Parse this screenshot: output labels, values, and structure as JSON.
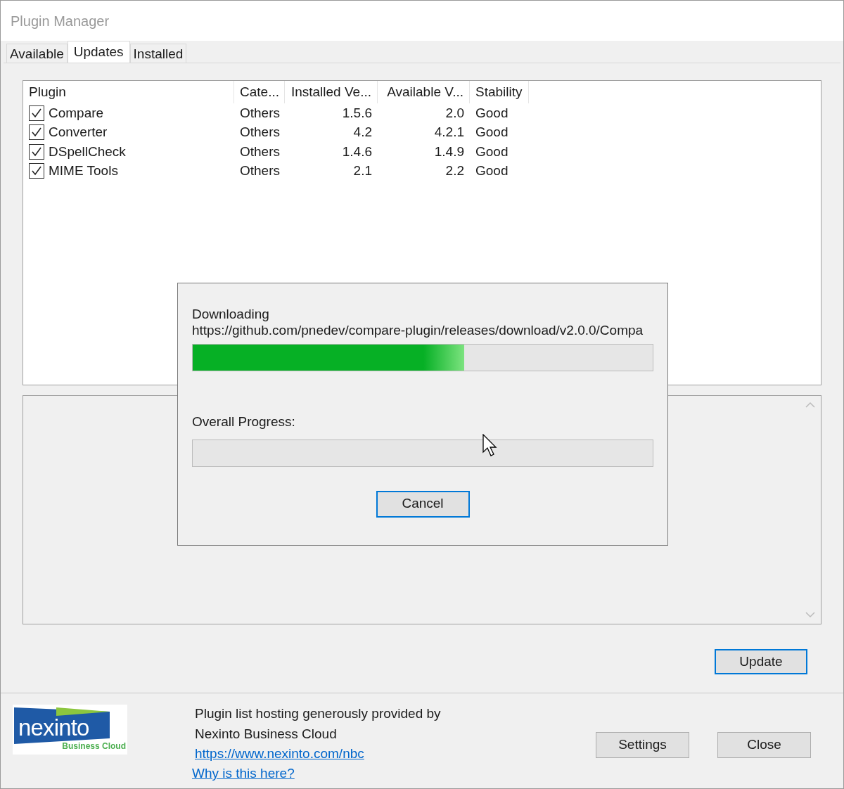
{
  "window": {
    "title": "Plugin Manager"
  },
  "tabs": [
    {
      "label": "Available",
      "selected": false
    },
    {
      "label": "Updates",
      "selected": true
    },
    {
      "label": "Installed",
      "selected": false
    }
  ],
  "table": {
    "columns": [
      {
        "label": "Plugin"
      },
      {
        "label": "Cate..."
      },
      {
        "label": "Installed Ve..."
      },
      {
        "label": "Available V..."
      },
      {
        "label": "Stability"
      }
    ],
    "rows": [
      {
        "checked": true,
        "cells": [
          "Compare",
          "Others",
          "1.5.6",
          "2.0",
          "Good"
        ]
      },
      {
        "checked": true,
        "cells": [
          "Converter",
          "Others",
          "4.2",
          "4.2.1",
          "Good"
        ]
      },
      {
        "checked": true,
        "cells": [
          "DSpellCheck",
          "Others",
          "1.4.6",
          "1.4.9",
          "Good"
        ]
      },
      {
        "checked": true,
        "cells": [
          "MIME Tools",
          "Others",
          "2.1",
          "2.2",
          "Good"
        ]
      }
    ]
  },
  "progress_dialog": {
    "heading": "Downloading",
    "url": "https://github.com/pnedev/compare-plugin/releases/download/v2.0.0/Compa",
    "download": {
      "level": 0.59
    },
    "overall_label": "Overall Progress:",
    "overall": {
      "level": 0
    },
    "cancel_button": "Cancel"
  },
  "update_button": "Update",
  "footer": {
    "logo": {
      "name": "nexinto",
      "tagline": "Business Cloud"
    },
    "lines": [
      "Plugin list hosting generously provided by",
      "Nexinto Business Cloud"
    ],
    "links": [
      "https://www.nexinto.com/nbc",
      "Why is this here?"
    ],
    "buttons": [
      "Settings",
      "Close"
    ]
  }
}
